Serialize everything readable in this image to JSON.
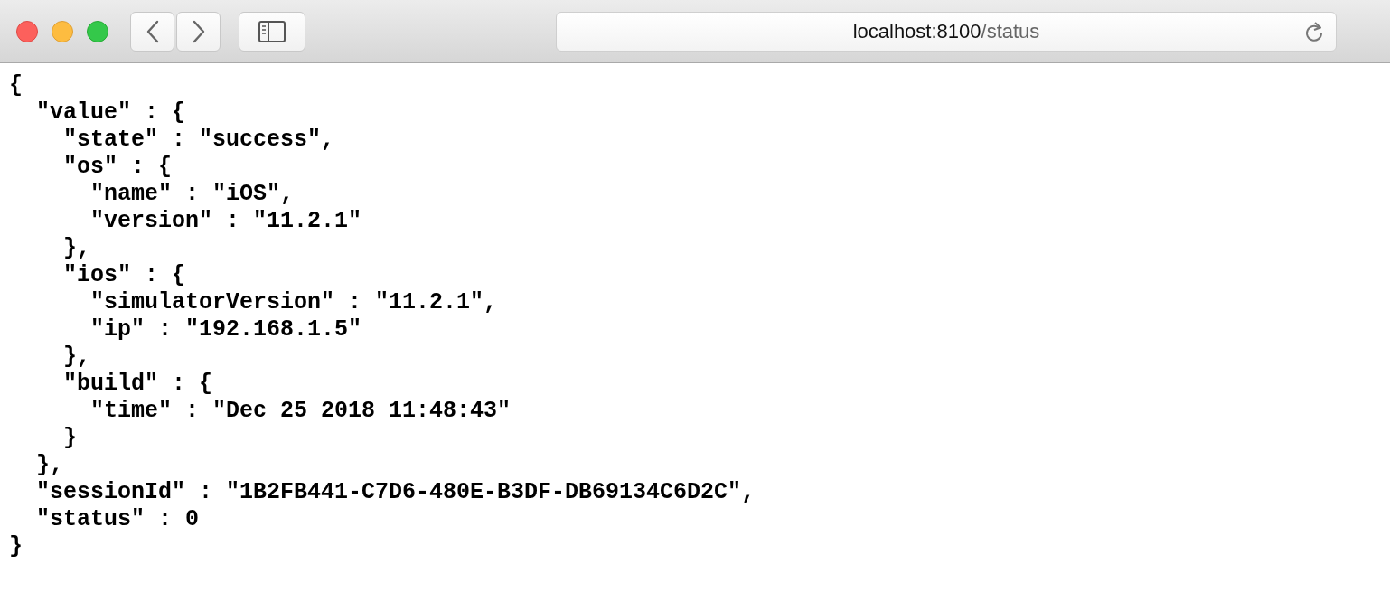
{
  "toolbar": {
    "address": {
      "host": "localhost:8100",
      "path": "/status"
    }
  },
  "listing": [
    {
      "text": "{",
      "children": [
        {
          "text": "\"value\" : {",
          "children": [
            {
              "text": "\"state\" : \"success\","
            },
            {
              "text": "\"os\" : {",
              "children": [
                {
                  "text": "\"name\" : \"iOS\","
                },
                {
                  "text": "\"version\" : \"11.2.1\""
                }
              ]
            },
            {
              "text": "},"
            },
            {
              "text": "\"ios\" : {",
              "children": [
                {
                  "text": "\"simulatorVersion\" : \"11.2.1\","
                },
                {
                  "text": "\"ip\" : \"192.168.1.5\""
                }
              ]
            },
            {
              "text": "},"
            },
            {
              "text": "\"build\" : {",
              "children": [
                {
                  "text": "\"time\" : \"Dec 25 2018 11:48:43\""
                }
              ]
            },
            {
              "text": "}"
            }
          ]
        },
        {
          "text": "},"
        },
        {
          "text": "\"sessionId\" : \"1B2FB441-C7D6-480E-B3DF-DB69134C6D2C\","
        },
        {
          "text": "\"status\" : 0"
        }
      ]
    },
    {
      "text": "}"
    }
  ]
}
